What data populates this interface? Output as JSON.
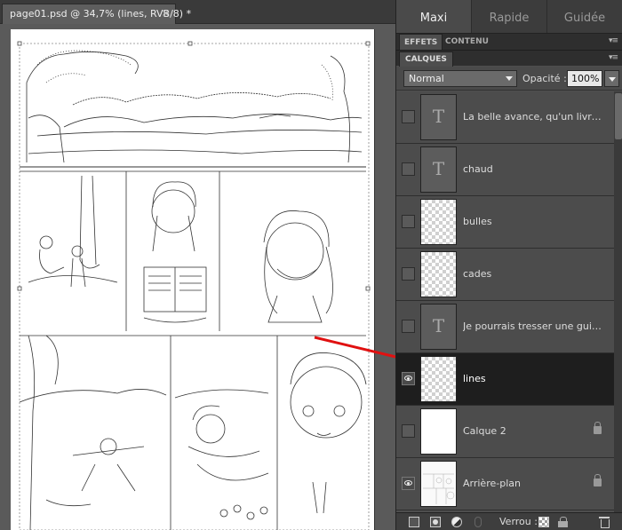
{
  "document": {
    "tab_title": "page01.psd @ 34,7% (lines, RVB/8) *",
    "close_glyph": "×"
  },
  "mode_tabs": [
    {
      "label": "Maxi",
      "active": true
    },
    {
      "label": "Rapide",
      "active": false
    },
    {
      "label": "Guidée",
      "active": false
    }
  ],
  "sub_tabs": {
    "effets": "EFFETS",
    "contenu": "CONTENU",
    "calques": "CALQUES",
    "menu_glyph": "▾≡"
  },
  "blend": {
    "mode": "Normal",
    "opacity_label": "Opacité :",
    "opacity_value": "100%"
  },
  "layers": [
    {
      "name": "La belle avance, qu'un livre sa...",
      "thumb": "text",
      "visible": false,
      "locked": false,
      "selected": false
    },
    {
      "name": "chaud",
      "thumb": "text",
      "visible": false,
      "locked": false,
      "selected": false
    },
    {
      "name": "bulles",
      "thumb": "checker",
      "visible": false,
      "locked": false,
      "selected": false
    },
    {
      "name": "cades",
      "thumb": "checker",
      "visible": false,
      "locked": false,
      "selected": false
    },
    {
      "name": "Je pourrais tresser une guirlan...",
      "thumb": "text",
      "visible": false,
      "locked": false,
      "selected": false
    },
    {
      "name": "lines",
      "thumb": "checker",
      "visible": true,
      "locked": false,
      "selected": true
    },
    {
      "name": "Calque 2",
      "thumb": "white",
      "visible": false,
      "locked": true,
      "selected": false
    },
    {
      "name": "Arrière-plan",
      "thumb": "sketch",
      "visible": true,
      "locked": true,
      "selected": false
    }
  ],
  "bottom_bar": {
    "lock_label": "Verrou :"
  },
  "annotation": {
    "arrow_color": "#e01010"
  },
  "icons": {
    "text_layer_glyph": "T"
  }
}
